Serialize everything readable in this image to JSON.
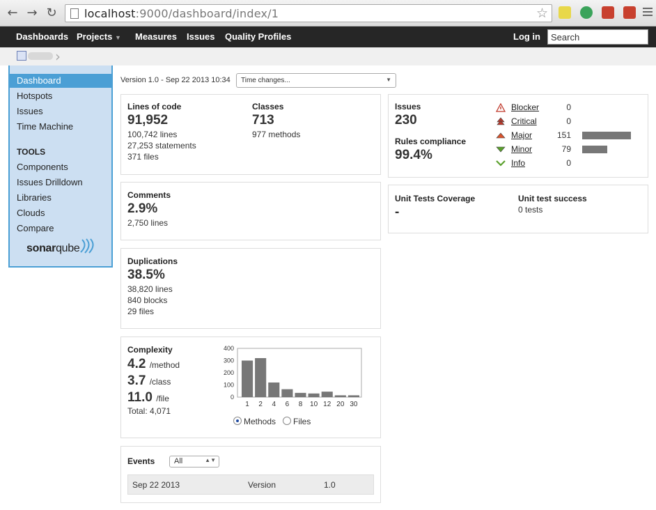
{
  "browser": {
    "url_host": "localhost",
    "url_path": ":9000/dashboard/index/1"
  },
  "topnav": {
    "items": [
      "Dashboards",
      "Projects",
      "Measures",
      "Issues",
      "Quality Profiles"
    ],
    "login": "Log in",
    "search_placeholder": "Search"
  },
  "sidebar": {
    "items": [
      "Dashboard",
      "Hotspots",
      "Issues",
      "Time Machine"
    ],
    "tools_header": "TOOLS",
    "tools": [
      "Components",
      "Issues Drilldown",
      "Libraries",
      "Clouds",
      "Compare"
    ],
    "logo_a": "sonar",
    "logo_b": "qube"
  },
  "header": {
    "version": "Version 1.0 - Sep 22 2013 10:34",
    "time_select": "Time changes..."
  },
  "size": {
    "loc_label": "Lines of code",
    "loc_value": "91,952",
    "lines": "100,742 lines",
    "statements": "27,253 statements",
    "files": "371 files",
    "classes_label": "Classes",
    "classes_value": "713",
    "methods": "977 methods"
  },
  "comments": {
    "label": "Comments",
    "value": "2.9%",
    "lines": "2,750 lines"
  },
  "duplications": {
    "label": "Duplications",
    "value": "38.5%",
    "lines": "38,820 lines",
    "blocks": "840 blocks",
    "files": "29 files"
  },
  "complexity": {
    "label": "Complexity",
    "per_method": "4.2",
    "per_method_unit": "/method",
    "per_class": "3.7",
    "per_class_unit": "/class",
    "per_file": "11.0",
    "per_file_unit": "/file",
    "total": "Total: 4,071",
    "radio_methods": "Methods",
    "radio_files": "Files"
  },
  "chart_data": {
    "type": "bar",
    "categories": [
      "1",
      "2",
      "4",
      "6",
      "8",
      "10",
      "12",
      "20",
      "30"
    ],
    "values": [
      300,
      320,
      120,
      65,
      35,
      30,
      45,
      15,
      15
    ],
    "ylim": [
      0,
      400
    ],
    "yticks": [
      "400",
      "300",
      "200",
      "100",
      "0"
    ],
    "bar_color": "#777777",
    "grid": false
  },
  "issues": {
    "label": "Issues",
    "value": "230",
    "compliance_label": "Rules compliance",
    "compliance_value": "99.4%",
    "severities": [
      {
        "name": "Blocker",
        "count": "0",
        "fraction": 0,
        "icon": "blocker-icon"
      },
      {
        "name": "Critical",
        "count": "0",
        "fraction": 0,
        "icon": "critical-icon"
      },
      {
        "name": "Major",
        "count": "151",
        "fraction": 1.0,
        "icon": "major-icon"
      },
      {
        "name": "Minor",
        "count": "79",
        "fraction": 0.52,
        "icon": "minor-icon"
      },
      {
        "name": "Info",
        "count": "0",
        "fraction": 0,
        "icon": "info-icon"
      }
    ]
  },
  "tests": {
    "coverage_label": "Unit Tests Coverage",
    "coverage_value": "-",
    "success_label": "Unit test success",
    "success_value": "0 tests"
  },
  "events": {
    "label": "Events",
    "filter": "All",
    "rows": [
      {
        "date": "Sep 22 2013",
        "type": "Version",
        "value": "1.0"
      }
    ]
  },
  "colors": {
    "topnav_bg": "#262626",
    "sidebar_bg": "#ccdff2",
    "sidebar_active": "#4b9fd5"
  }
}
